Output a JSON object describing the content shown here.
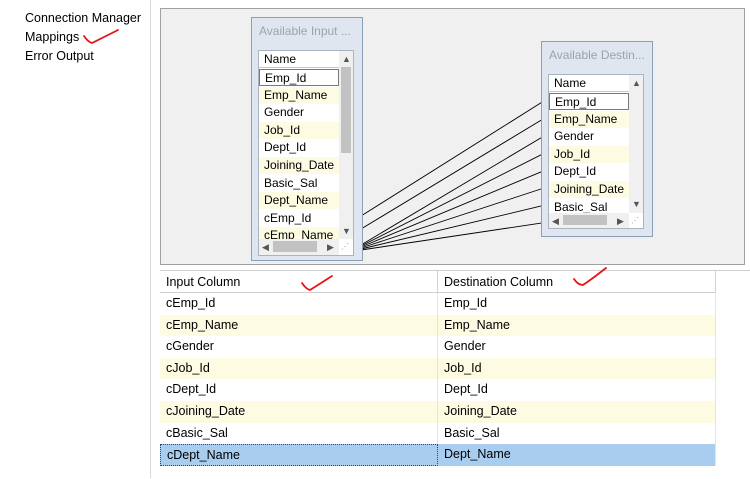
{
  "sidebar": {
    "items": [
      {
        "label": "Connection Manager"
      },
      {
        "label": "Mappings"
      },
      {
        "label": "Error Output"
      }
    ]
  },
  "input_panel": {
    "title": "Available Input ...",
    "header": "Name",
    "columns": [
      "Emp_Id",
      "Emp_Name",
      "Gender",
      "Job_Id",
      "Dept_Id",
      "Joining_Date",
      "Basic_Sal",
      "Dept_Name",
      "cEmp_Id",
      "cEmp_Name"
    ]
  },
  "destination_panel": {
    "title": "Available Destin...",
    "header": "Name",
    "columns": [
      "Emp_Id",
      "Emp_Name",
      "Gender",
      "Job_Id",
      "Dept_Id",
      "Joining_Date",
      "Basic_Sal"
    ]
  },
  "grid": {
    "headers": [
      "Input Column",
      "Destination Column"
    ],
    "rows": [
      [
        "cEmp_Id",
        "Emp_Id"
      ],
      [
        "cEmp_Name",
        "Emp_Name"
      ],
      [
        "cGender",
        "Gender"
      ],
      [
        "cJob_Id",
        "Job_Id"
      ],
      [
        "cDept_Id",
        "Dept_Id"
      ],
      [
        "cJoining_Date",
        "Joining_Date"
      ],
      [
        "cBasic_Sal",
        "Basic_Sal"
      ],
      [
        "cDept_Name",
        "Dept_Name"
      ]
    ],
    "selected_row": 7
  },
  "icons": {
    "scroll_up": "▲",
    "scroll_down": "▼",
    "scroll_left": "◀",
    "scroll_right": "▶",
    "resize_grip": "⋰"
  },
  "colors": {
    "alt_row": "#fdfbe2",
    "selected_row": "#a8cdef",
    "annotation": "#e8141a"
  }
}
